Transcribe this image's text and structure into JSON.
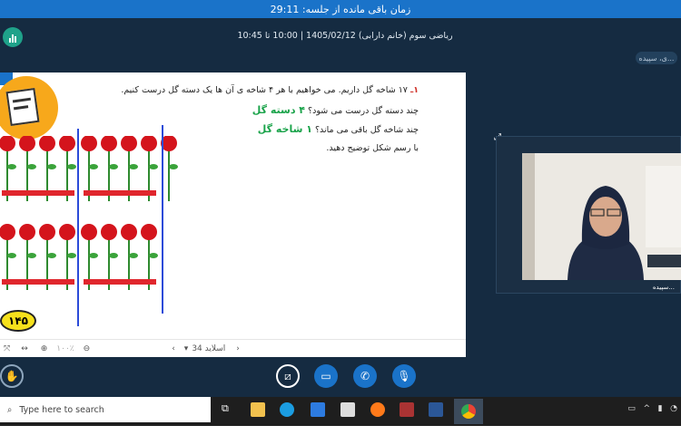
{
  "topbar": {
    "timer_text": "زمان باقی مانده از جلسه: 29:11"
  },
  "header": {
    "session_info": "ریاضی سوم (خانم دارابی) 1405/02/12 | 10:00 تا 10:45"
  },
  "participant_chip": {
    "label": "...ی، سپیده"
  },
  "slide": {
    "question_number": "۱ـ",
    "line1": "۱۷ شاخه گل داریم. می خواهیم با هر ۴ شاخه ی آن ها یک دسته گل درست کنیم.",
    "line2": "چند دسته گل درست می شود؟",
    "answer1": "۴ دسته گل",
    "line3": "چند شاخه گل باقی می ماند؟",
    "answer2": "۱ شاخه گل",
    "line4": "با رسم شکل توضیح دهید.",
    "page_number": "۱۴۵"
  },
  "slide_toolbar": {
    "slide_label": "اسلاید 34",
    "zoom": "۱۰۰٪"
  },
  "video": {
    "name": "...سپیده"
  },
  "taskbar": {
    "search_placeholder": "Type here to search"
  },
  "colors": {
    "accent": "#1a73c9",
    "app_bg": "#152b41",
    "answer_green": "#1aa34a"
  }
}
